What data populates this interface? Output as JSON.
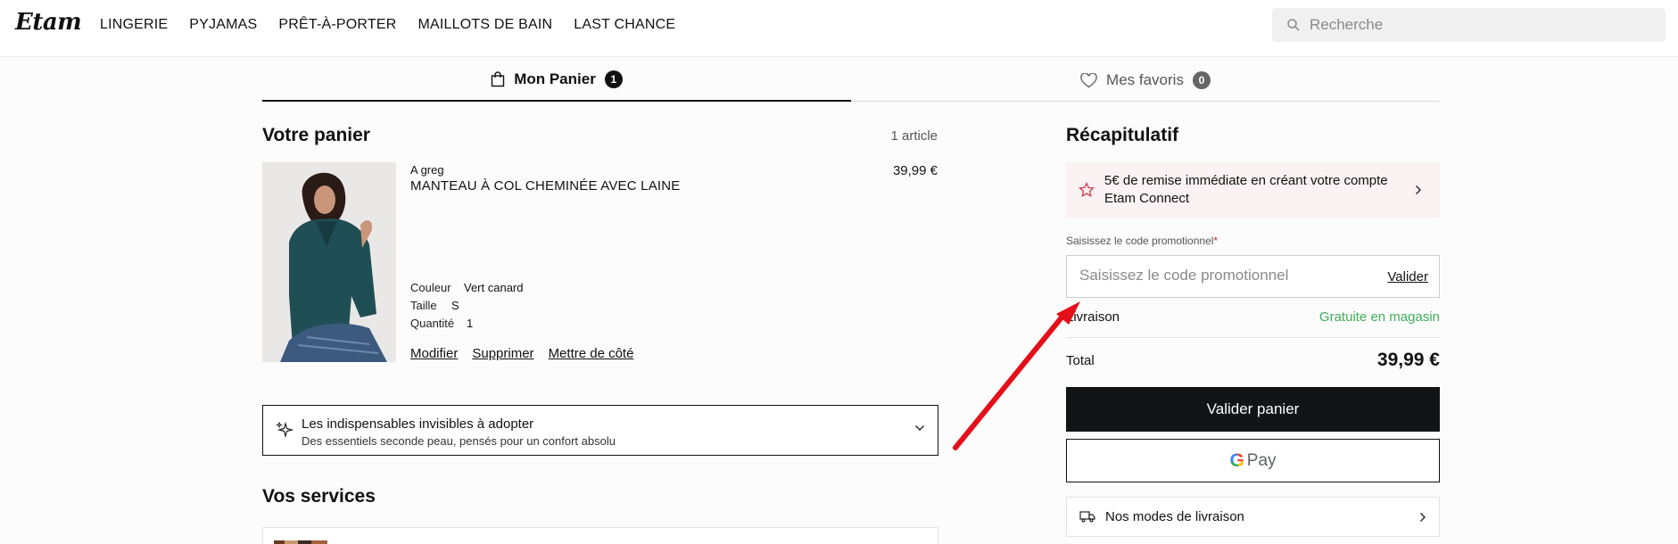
{
  "header": {
    "logo": "Etam",
    "nav": [
      "LINGERIE",
      "PYJAMAS",
      "PRÊT-À-PORTER",
      "MAILLOTS DE BAIN",
      "LAST CHANCE"
    ],
    "search_placeholder": "Recherche"
  },
  "tabs": {
    "cart_label": "Mon Panier",
    "cart_count": "1",
    "favorites_label": "Mes favoris",
    "favorites_count": "0"
  },
  "cart": {
    "title": "Votre panier",
    "item_count": "1 article",
    "item": {
      "brand": "A greg",
      "name": "MANTEAU À COL CHEMINÉE AVEC LAINE",
      "price": "39,99 €",
      "color_label": "Couleur",
      "color_value": "Vert canard",
      "size_label": "Taille",
      "size_value": "S",
      "qty_label": "Quantité",
      "qty_value": "1",
      "actions": [
        "Modifier",
        "Supprimer",
        "Mettre de côté"
      ]
    },
    "accordion": {
      "title": "Les indispensables invisibles à adopter",
      "subtitle": "Des essentiels seconde peau, pensés pour un confort absolu"
    },
    "services_title": "Vos services"
  },
  "summary": {
    "title": "Récapitulatif",
    "promo_banner": "5€ de remise immédiate en créant votre compte Etam Connect",
    "promo_label": "Saisissez le code promotionnel",
    "promo_required": "*",
    "promo_placeholder": "Saisissez le code promotionnel",
    "promo_apply": "Valider",
    "shipping_label": "Livraison",
    "shipping_value": "Gratuite en magasin",
    "total_label": "Total",
    "total_value": "39,99 €",
    "checkout_label": "Valider panier",
    "gpay_g": "G",
    "gpay_label": "Pay",
    "delivery_label": "Nos modes de livraison"
  },
  "colors": {
    "accent_dark": "#111516",
    "free_green": "#3fae5a",
    "promo_bg": "#fbf3f3",
    "annotation_arrow": "#e3101a"
  }
}
